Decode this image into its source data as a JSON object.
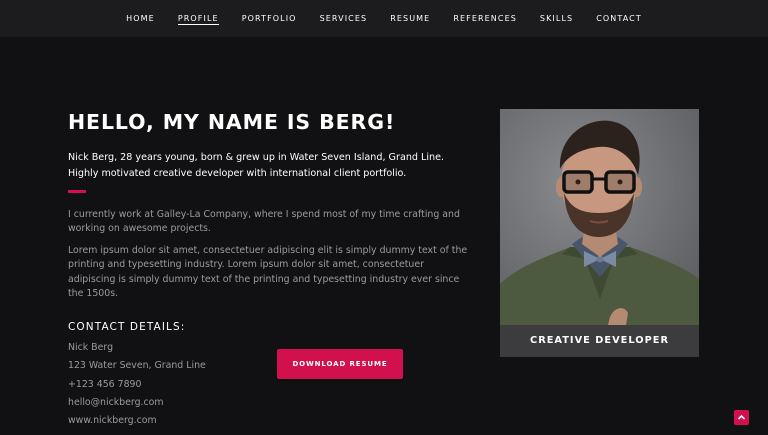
{
  "nav": {
    "items": [
      {
        "label": "HOME",
        "active": false
      },
      {
        "label": "PROFILE",
        "active": true
      },
      {
        "label": "PORTFOLIO",
        "active": false
      },
      {
        "label": "SERVICES",
        "active": false
      },
      {
        "label": "RESUME",
        "active": false
      },
      {
        "label": "REFERENCES",
        "active": false
      },
      {
        "label": "SKILLS",
        "active": false
      },
      {
        "label": "CONTACT",
        "active": false
      }
    ]
  },
  "profile": {
    "heading": "HELLO, MY NAME IS BERG!",
    "intro": "Nick Berg, 28 years young, born & grew up in Water Seven Island, Grand Line. Highly motivated creative developer with international client portfolio.",
    "paragraphs": [
      "I currently work at Galley-La Company, where I spend most of my time crafting and working on awesome projects.",
      "Lorem ipsum dolor sit amet, consectetuer adipiscing elit is simply dummy text of the printing and typesetting industry. Lorem ipsum dolor sit amet, consectetuer adipiscing is simply dummy text of the printing and typesetting industry ever since the 1500s."
    ]
  },
  "contact": {
    "heading": "CONTACT DETAILS:",
    "items": [
      "Nick Berg",
      "123 Water Seven, Grand Line",
      "+123 456 7890",
      "hello@nickberg.com",
      "www.nickberg.com"
    ]
  },
  "download_button": {
    "label": "DOWNLOAD RESUME"
  },
  "card": {
    "caption": "CREATIVE DEVELOPER"
  },
  "scroll_top": {
    "icon": "chevron-up-icon"
  },
  "colors": {
    "accent": "#d1104d",
    "background": "#111012",
    "navbar": "#1c1c1e",
    "card_caption": "#3c3b3d"
  }
}
